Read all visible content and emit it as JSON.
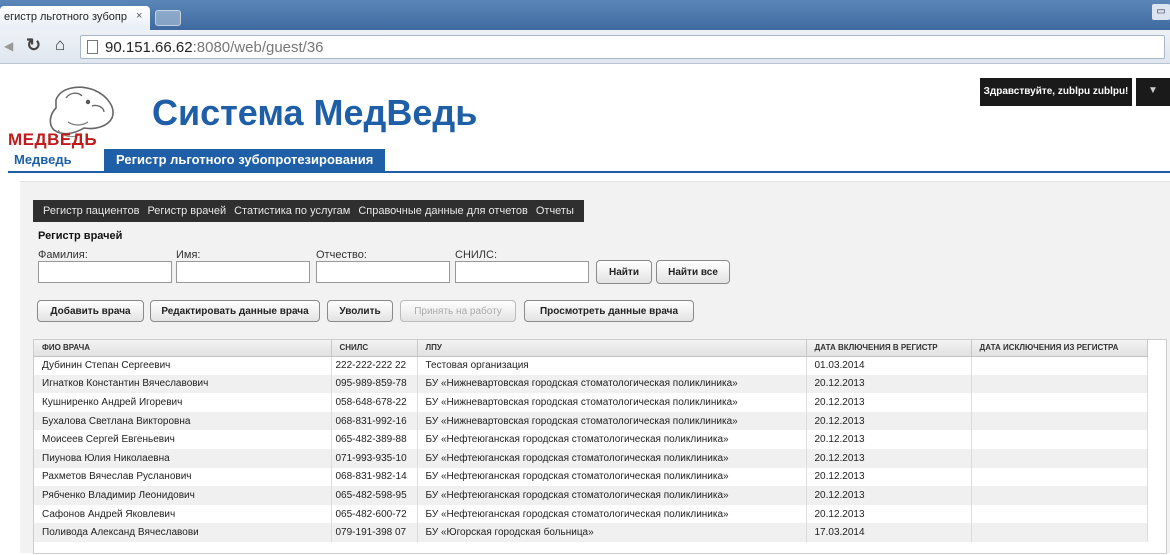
{
  "browser": {
    "tab_title": "егистр льготного зубопр",
    "tab_close": "×",
    "url_host": "90.151.66.62",
    "url_rest": ":8080/web/guest/36",
    "window_control": "▭"
  },
  "header": {
    "logo_text": "МЕДВЕДЬ",
    "site_title": "Система МедВедь",
    "greeting": "Здравствуйте, zublpu zublpu!",
    "greeting_menu": "▼"
  },
  "nav": {
    "items": [
      {
        "label": "Медведь"
      },
      {
        "label": "Регистр льготного зубопротезирования"
      }
    ]
  },
  "menu": {
    "items": [
      {
        "label": "Регистр пациентов"
      },
      {
        "label": "Регистр врачей"
      },
      {
        "label": "Статистика по услугам"
      },
      {
        "label": "Справочные данные для отчетов"
      },
      {
        "label": "Отчеты"
      }
    ]
  },
  "filter": {
    "title": "Регистр врачей",
    "fields": [
      {
        "label": "Фамилия:",
        "value": ""
      },
      {
        "label": "Имя:",
        "value": ""
      },
      {
        "label": "Отчество:",
        "value": ""
      },
      {
        "label": "СНИЛС:",
        "value": ""
      }
    ],
    "find": "Найти",
    "find_all": "Найти все"
  },
  "actions": {
    "add": "Добавить врача",
    "edit": "Редактировать данные врача",
    "dismiss": "Уволить",
    "hire": "Принять на работу",
    "view": "Просмотреть данные врача"
  },
  "table": {
    "columns": [
      "ФИО ВРАЧА",
      "СНИЛС",
      "ЛПУ",
      "ДАТА ВКЛЮЧЕНИЯ В РЕГИСТР",
      "ДАТА ИСКЛЮЧЕНИЯ ИЗ РЕГИСТРА"
    ],
    "rows": [
      [
        "Дубинин Степан Сергеевич",
        "222-222-222 22",
        "Тестовая организация",
        "01.03.2014",
        ""
      ],
      [
        "Игнатков Константин Вячеславович",
        "095-989-859-78",
        "БУ «Нижневартовская городская стоматологическая поликлиника»",
        "20.12.2013",
        ""
      ],
      [
        "Кушниренко Андрей Игоревич",
        "058-648-678-22",
        "БУ «Нижневартовская городская стоматологическая поликлиника»",
        "20.12.2013",
        ""
      ],
      [
        "Бухалова Светлана Викторовна",
        "068-831-992-16",
        "БУ «Нижневартовская городская стоматологическая поликлиника»",
        "20.12.2013",
        ""
      ],
      [
        "Моисеев Сергей Евгеньевич",
        "065-482-389-88",
        "БУ «Нефтеюганская городская стоматологическая поликлиника»",
        "20.12.2013",
        ""
      ],
      [
        "Пиунова Юлия Николаевна",
        "071-993-935-10",
        "БУ «Нефтеюганская городская стоматологическая поликлиника»",
        "20.12.2013",
        ""
      ],
      [
        "Рахметов Вячеслав Русланович",
        "068-831-982-14",
        "БУ «Нефтеюганская городская стоматологическая поликлиника»",
        "20.12.2013",
        ""
      ],
      [
        "Рябченко Владимир Леонидович",
        "065-482-598-95",
        "БУ «Нефтеюганская городская стоматологическая поликлиника»",
        "20.12.2013",
        ""
      ],
      [
        "Сафонов Андрей Яковлевич",
        "065-482-600-72",
        "БУ «Нефтеюганская городская стоматологическая поликлиника»",
        "20.12.2013",
        ""
      ],
      [
        "Поливода Александ Вячеславови",
        "079-191-398 07",
        "БУ «Югорская городская больница»",
        "17.03.2014",
        ""
      ]
    ]
  },
  "colors": {
    "brand_blue": "#1f5fa8",
    "logo_red": "#c01a1a",
    "menu_dark": "#2f2f2f"
  },
  "icons": [
    "reload-icon",
    "home-icon",
    "page-icon",
    "bear-logo-icon",
    "chevron-down-icon"
  ]
}
